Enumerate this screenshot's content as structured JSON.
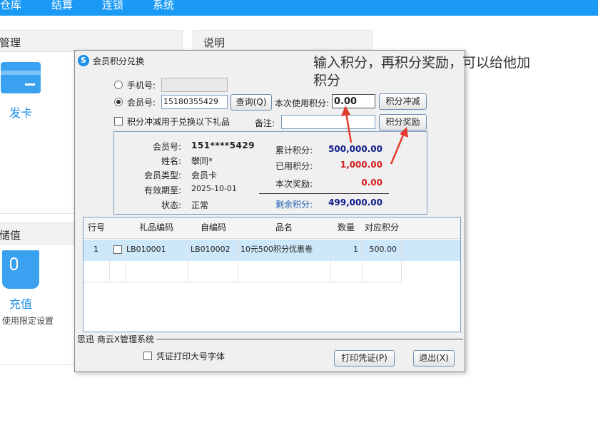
{
  "topbar": {
    "items": [
      "仓库",
      "结算",
      "连锁",
      "系统"
    ],
    "color": "#1a9af4"
  },
  "left_panel": {
    "title": "管理",
    "card_label": "发卡"
  },
  "desc_panel": {
    "title": "说明"
  },
  "store_panel": {
    "title": "储值",
    "recharge_label": "充值",
    "limit_label": "使用限定设置"
  },
  "dialog": {
    "title": "会员积分兑换",
    "phone_label": "手机号:",
    "member_label": "会员号:",
    "member_value": "15180355429",
    "query_button": "查询(Q)",
    "use_points_label": "本次使用积分:",
    "use_points_value": "0.00",
    "offset_button": "积分冲减",
    "reward_button": "积分奖励",
    "offset_gift_checkbox": "积分冲减用于兑换以下礼品",
    "remark_label": "备注:",
    "info": {
      "member_no_label": "会员号:",
      "member_no": "151****5429",
      "name_label": "姓名:",
      "name": "攀同*",
      "type_label": "会员类型:",
      "type": "会员卡",
      "expiry_label": "有效期至:",
      "expiry": "2025-10-01",
      "status_label": "状态:",
      "status": "正常",
      "total_label": "累计积分:",
      "total": "500,000.00",
      "used_label": "已用积分:",
      "used": "1,000.00",
      "reward_label": "本次奖励:",
      "reward": "0.00",
      "remaining_label": "剩余积分:",
      "remaining": "499,000.00"
    },
    "table": {
      "headers": [
        "行号",
        "礼品编码",
        "自编码",
        "品名",
        "数量",
        "对应积分"
      ],
      "rows": [
        {
          "no": "1",
          "code": "LB010001",
          "self_code": "LB010002",
          "name": "10元500积分优惠卷",
          "qty": "1",
          "points": "500.00"
        }
      ]
    },
    "status_text": "思迅 商云X管理系统",
    "big_font_checkbox": "凭证打印大号字体",
    "print_button": "打印凭证(P)",
    "exit_button": "退出(X)"
  },
  "annotation": {
    "line1": "输入积分，再积分奖励，可以给他加",
    "line2": "积分",
    "arrow_color": "#e23b2e"
  },
  "colors": {
    "accent_blue": "#1a8ee8",
    "value_navy": "#0d1a8a",
    "value_red": "#d21f1f",
    "row_highlight": "#cde8f8"
  }
}
